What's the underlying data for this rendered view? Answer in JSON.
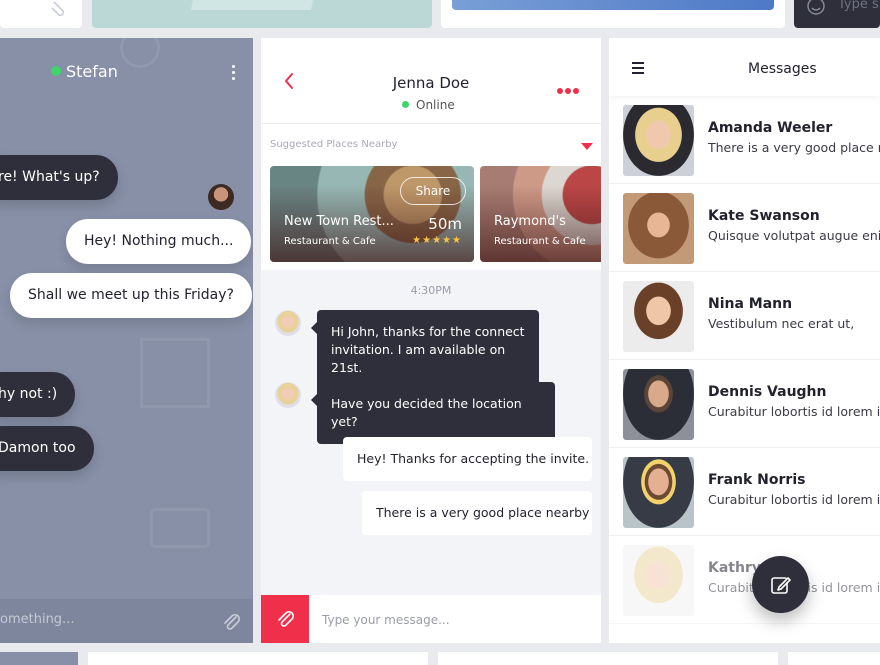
{
  "left_chat": {
    "contact_name": "Stefan",
    "messages": [
      {
        "text": "re! What's up?",
        "from": "other"
      },
      {
        "text": "Hey! Nothing much...",
        "from": "me"
      },
      {
        "text": "Shall we meet up this Friday?",
        "from": "me"
      },
      {
        "text": "hy not :)",
        "from": "other"
      },
      {
        "text": "Damon too",
        "from": "other"
      }
    ],
    "input_placeholder": "omething..."
  },
  "chat": {
    "contact_name": "Jenna Doe",
    "status": "Online",
    "places_label": "Suggested Places Nearby",
    "places": [
      {
        "name": "New Town Rest...",
        "type": "Restaurant & Cafe",
        "distance": "50m",
        "rating": 5,
        "stars": "★★★★★",
        "share_label": "Share"
      },
      {
        "name": "Raymond's",
        "type": "Restaurant & Cafe"
      }
    ],
    "time_label": "4:30PM",
    "messages": [
      {
        "from": "other",
        "lines": [
          "Hi John, thanks for the connect",
          "invitation. I am available on 21st."
        ]
      },
      {
        "from": "other",
        "lines": [
          "Have you decided the location yet?"
        ]
      },
      {
        "from": "me",
        "lines": [
          "Hey! Thanks for accepting the invite."
        ]
      },
      {
        "from": "me",
        "lines": [
          "There is a very good place nearby"
        ]
      }
    ],
    "input_placeholder": "Type your message..."
  },
  "messages_list": {
    "title": "Messages",
    "contacts": [
      {
        "name": "Amanda Weeler",
        "preview": "There is a very good place nea..."
      },
      {
        "name": "Kate Swanson",
        "preview": "Quisque volutpat augue enim,"
      },
      {
        "name": "Nina Mann",
        "preview": "Vestibulum nec erat ut,"
      },
      {
        "name": "Dennis Vaughn",
        "preview": "Curabitur lobortis id lorem id"
      },
      {
        "name": "Frank Norris",
        "preview": "Curabitur lobortis id lorem id"
      },
      {
        "name": "Kathryn",
        "preview": "Curabitur lobortis id lorem id"
      }
    ]
  },
  "top_strip": {
    "input_hint": "Type s"
  },
  "colors": {
    "accent": "#f0304b",
    "dark_bubble": "#2f2f3c",
    "online": "#3ed66b",
    "left_panel_bg": "#8790a7"
  },
  "icons": [
    "paperclip-icon",
    "back-chevron-icon",
    "more-dots-icon",
    "hamburger-menu-icon",
    "compose-icon",
    "smiley-icon",
    "caret-down-icon",
    "star-icon"
  ]
}
